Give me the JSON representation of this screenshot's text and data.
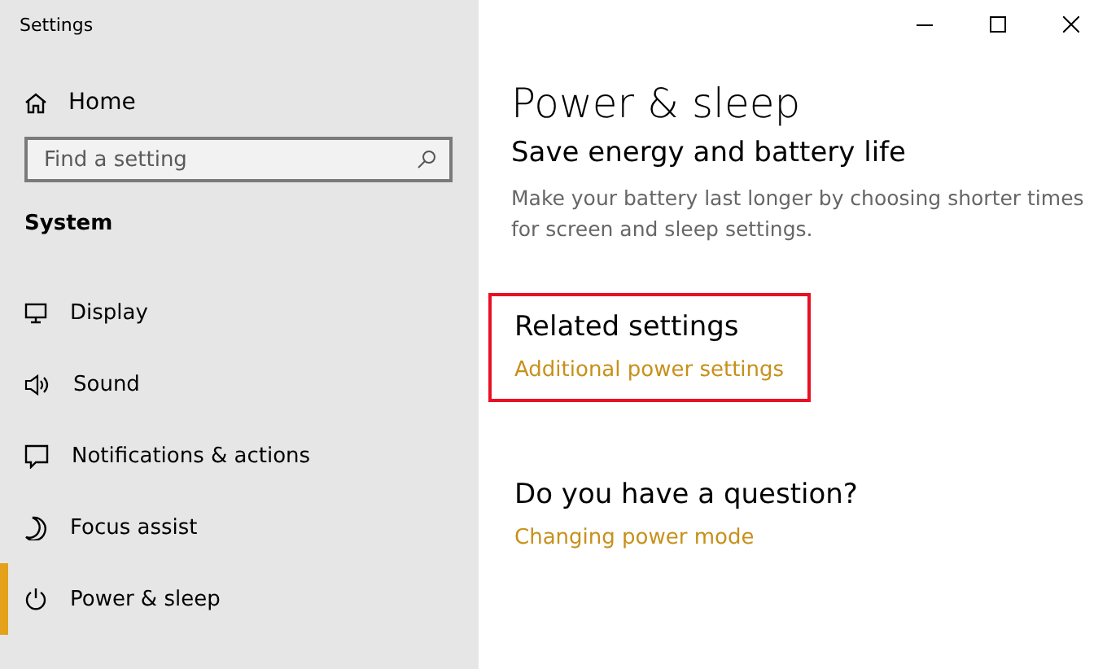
{
  "window": {
    "title": "Settings",
    "controls": [
      {
        "kind": "minimize"
      },
      {
        "kind": "maximize"
      },
      {
        "kind": "close"
      }
    ]
  },
  "sidebar": {
    "home": {
      "label": "Home"
    },
    "search": {
      "placeholder": "Find a setting"
    },
    "section": "System",
    "items": [
      {
        "label": "Display",
        "kind": "display",
        "selected": false
      },
      {
        "label": "Sound",
        "kind": "sound",
        "selected": false
      },
      {
        "label": "Notifications & actions",
        "kind": "notifications",
        "selected": false
      },
      {
        "label": "Focus assist",
        "kind": "focus",
        "selected": false
      },
      {
        "label": "Power & sleep",
        "kind": "power",
        "selected": true
      }
    ]
  },
  "page": {
    "title": "Power & sleep",
    "subtitle": "Save energy and battery life",
    "description": "Make your battery last longer by choosing shorter times for screen and sleep settings.",
    "sections": [
      {
        "heading": "Related settings",
        "link": "Additional power settings",
        "highlighted": true
      },
      {
        "heading": "Do you have a question?",
        "link": "Changing power mode",
        "highlighted": false
      }
    ]
  }
}
